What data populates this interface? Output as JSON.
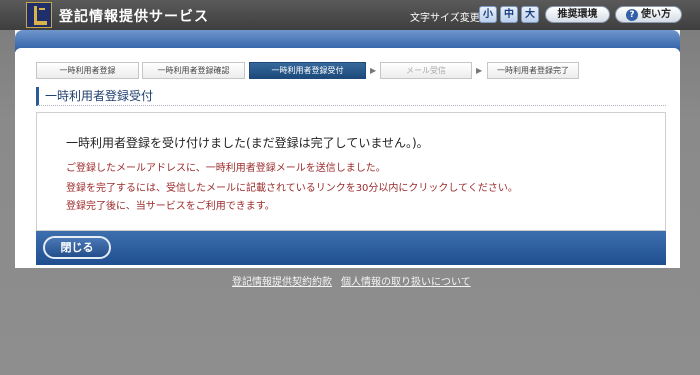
{
  "header": {
    "site_title": "登記情報提供サービス",
    "font_size_label": "文字サイズ変更",
    "font_sizes": [
      "小",
      "中",
      "大"
    ],
    "recommended_env": "推奨環境",
    "help_icon": "question-icon",
    "help_label": "使い方"
  },
  "steps": [
    {
      "label": "一時利用者登録",
      "state": "done"
    },
    {
      "label": "一時利用者登録確認",
      "state": "done"
    },
    {
      "label": "一時利用者登録受付",
      "state": "active"
    },
    {
      "label": "メール受信",
      "state": "future"
    },
    {
      "label": "一時利用者登録完了",
      "state": "done"
    }
  ],
  "step_arrow": "▶",
  "section": {
    "title": "一時利用者登録受付"
  },
  "message": {
    "main": "一時利用者登録を受け付けました(まだ登録は完了していません。)。",
    "lines": [
      "ご登録したメールアドレスに、一時利用者登録メールを送信しました。",
      "登録を完了するには、受信したメールに記載されているリンクを30分以内にクリックしてください。",
      "登録完了後に、当サービスをご利用できます。"
    ]
  },
  "actions": {
    "close_label": "閉じる"
  },
  "footer": {
    "terms_link": "登記情報提供契約約款",
    "privacy_link": "個人情報の取り扱いについて"
  },
  "colors": {
    "accent_blue": "#2c5da5",
    "active_step": "#1d4a7b",
    "warning_red": "#9b2b2b"
  }
}
